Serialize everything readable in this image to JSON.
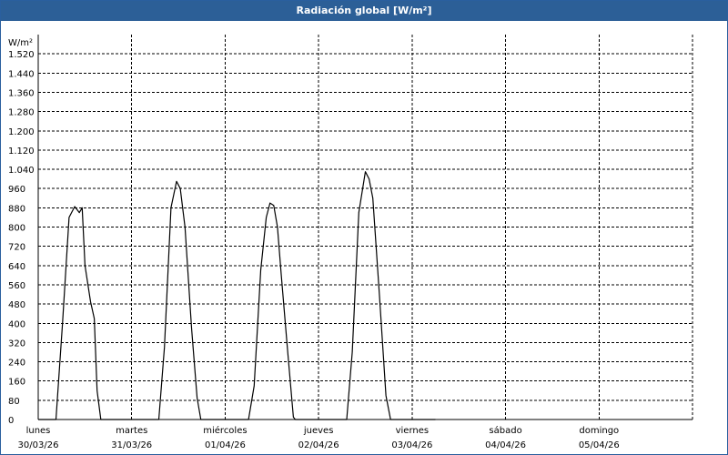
{
  "window": {
    "title": "Radiación global [W/m²]"
  },
  "chart_data": {
    "type": "line",
    "title": "Radiación global [W/m²]",
    "ylabel": "W/m²",
    "ylim": [
      0,
      1600
    ],
    "yticks": [
      0,
      80,
      160,
      240,
      320,
      400,
      480,
      560,
      640,
      720,
      800,
      880,
      960,
      1040,
      1120,
      1200,
      1280,
      1360,
      1440,
      1520
    ],
    "ytick_labels": [
      "0",
      "80",
      "160",
      "240",
      "320",
      "400",
      "480",
      "560",
      "640",
      "720",
      "800",
      "880",
      "960",
      "1.040",
      "1.120",
      "1.200",
      "1.280",
      "1.360",
      "1.440",
      "1.520"
    ],
    "xlim_days": [
      0,
      7
    ],
    "x_ticks": [
      {
        "day": "lunes",
        "date": "30/03/26"
      },
      {
        "day": "martes",
        "date": "31/03/26"
      },
      {
        "day": "miércoles",
        "date": "01/04/26"
      },
      {
        "day": "jueves",
        "date": "02/04/26"
      },
      {
        "day": "viernes",
        "date": "03/04/26"
      },
      {
        "day": "sábado",
        "date": "04/04/26"
      },
      {
        "day": "domingo",
        "date": "05/04/26"
      }
    ],
    "grid": true,
    "line_color": "#000000",
    "series": [
      {
        "points": [
          [
            0.0,
            0
          ],
          [
            0.19,
            0
          ],
          [
            0.26,
            400
          ],
          [
            0.33,
            840
          ],
          [
            0.39,
            885
          ],
          [
            0.44,
            860
          ],
          [
            0.47,
            880
          ],
          [
            0.5,
            640
          ],
          [
            0.56,
            490
          ],
          [
            0.6,
            420
          ],
          [
            0.63,
            120
          ],
          [
            0.67,
            0
          ],
          [
            1.0,
            0
          ],
          [
            1.29,
            0
          ],
          [
            1.35,
            300
          ],
          [
            1.42,
            880
          ],
          [
            1.48,
            990
          ],
          [
            1.52,
            960
          ],
          [
            1.57,
            800
          ],
          [
            1.64,
            380
          ],
          [
            1.7,
            90
          ],
          [
            1.74,
            0
          ],
          [
            2.0,
            0
          ],
          [
            2.25,
            0
          ],
          [
            2.31,
            140
          ],
          [
            2.38,
            620
          ],
          [
            2.44,
            840
          ],
          [
            2.48,
            900
          ],
          [
            2.52,
            890
          ],
          [
            2.56,
            800
          ],
          [
            2.6,
            600
          ],
          [
            2.67,
            280
          ],
          [
            2.73,
            10
          ],
          [
            2.75,
            0
          ],
          [
            3.0,
            0
          ],
          [
            3.3,
            0
          ],
          [
            3.36,
            280
          ],
          [
            3.43,
            860
          ],
          [
            3.5,
            1030
          ],
          [
            3.54,
            1000
          ],
          [
            3.58,
            920
          ],
          [
            3.65,
            520
          ],
          [
            3.72,
            100
          ],
          [
            3.77,
            0
          ],
          [
            4.0,
            0
          ],
          [
            4.25,
            0
          ]
        ]
      }
    ]
  }
}
